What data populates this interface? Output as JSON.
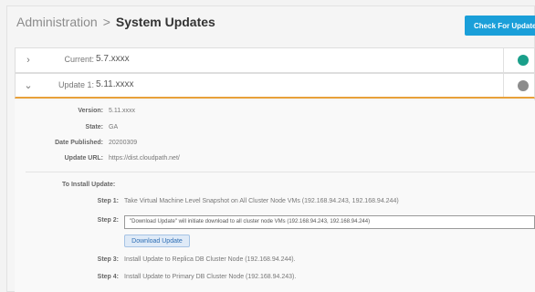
{
  "header": {
    "breadcrumb_root": "Administration",
    "breadcrumb_separator": ">",
    "breadcrumb_current": "System Updates",
    "check_button_label": "Check For Updates"
  },
  "rows": {
    "current": {
      "label": "Current:",
      "value": "5.7.xxxx",
      "status_color": "#1a9f8a",
      "chevron": "right-chevron-icon"
    },
    "update": {
      "label": "Update 1:",
      "value": "5.11.xxxx",
      "status_color": "#8c8c8c",
      "chevron": "down-chevron-icon"
    }
  },
  "details": {
    "version_label": "Version:",
    "version_value": "5.11.xxxx",
    "state_label": "State:",
    "state_value": "GA",
    "date_label": "Date Published:",
    "date_value": "20200309",
    "url_label": "Update URL:",
    "url_value": "https://dist.cloudpath.net/"
  },
  "install": {
    "title": "To Install Update:",
    "steps": [
      {
        "label": "Step 1:",
        "text": "Take Virtual Machine Level Snapshot on All Cluster Node VMs (192.168.94.243, 192.168.94.244)"
      },
      {
        "label": "Step 2:",
        "text": "\"Download Update\" will initiate download to all cluster node VMs (192.168.94.243, 192.168.94.244)",
        "button": "Download Update"
      },
      {
        "label": "Step 3:",
        "text": "Install Update to Replica DB Cluster Node (192.168.94.244)."
      },
      {
        "label": "Step 4:",
        "text": "Install Update to Primary DB Cluster Node (192.168.94.243)."
      }
    ]
  },
  "colors": {
    "accent": "#1a9fd9",
    "expanded_border": "#e8a13a",
    "status_ok": "#1a9f8a",
    "status_pending": "#8c8c8c"
  }
}
